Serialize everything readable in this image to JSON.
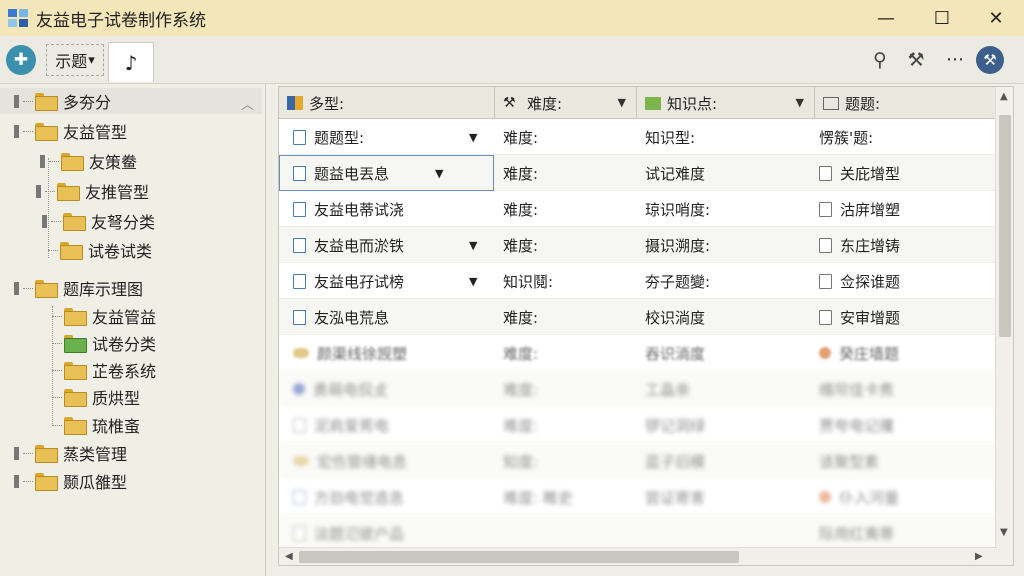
{
  "window": {
    "title": "友益电子试卷制作系统",
    "minimize_glyph": "—",
    "maximize_glyph": "☐",
    "close_glyph": "✕"
  },
  "toolbar": {
    "dropdown_label": "示题",
    "dropdown_caret": "▾",
    "tab_glyph": "♪",
    "more_glyph": "···"
  },
  "tree": {
    "items": [
      {
        "label": "多夯分"
      },
      {
        "label": "友益管型"
      },
      {
        "label": "友策鲞"
      },
      {
        "label": "友推管型"
      },
      {
        "label": "友弩分类"
      },
      {
        "label": "试卷试类"
      },
      {
        "label": "题库示理图"
      },
      {
        "label": "友益管益"
      },
      {
        "label": "试卷分类"
      },
      {
        "label": "芷卷系统"
      },
      {
        "label": "质烘型"
      },
      {
        "label": "琉椎蚉"
      },
      {
        "label": "蒸类管理"
      },
      {
        "label": "颞瓜雒型"
      }
    ]
  },
  "grid": {
    "headers": [
      {
        "label": "多型:"
      },
      {
        "label": "难度:"
      },
      {
        "label": "知识点:"
      },
      {
        "label": "题题:"
      }
    ],
    "rows": [
      {
        "c1": "题题型:",
        "c2": "难度:",
        "c3": "知识型:",
        "c4": "愣簇'题:"
      },
      {
        "c1": "题益电丟息",
        "c2": "难度:",
        "c3": "试记难度",
        "c4": "关庇增型"
      },
      {
        "c1": "友益电蒂试浇",
        "c2": "难度:",
        "c3": "琼识哨度:",
        "c4": "沽庰增塑"
      },
      {
        "c1": "友益电而淤铁",
        "c2": "难度:",
        "c3": "摄识溯度:",
        "c4": "东庄增铸"
      },
      {
        "c1": "友益电孖试榜",
        "c2": "知识鬩:",
        "c3": "夯子题變:",
        "c4": "佥探谁题"
      },
      {
        "c1": "友泓电荒息",
        "c2": "难度:",
        "c3": "校识淌度",
        "c4": "安审增题"
      },
      {
        "c1": "颜渠线徐觊塑",
        "c2": "难度:",
        "c3": "吞识淌度",
        "c4": "癸庄墙题"
      },
      {
        "c1": "勇萌电侃攴",
        "c2": "难度:",
        "c3": "工晶亲",
        "c4": "缗帘佳卡煮"
      },
      {
        "c1": "泥肩爱莠电",
        "c2": "难度:",
        "c3": "锣记洞绿",
        "c4": "贾夸电记攫"
      },
      {
        "c1": "宏伤管缮电息",
        "c2": "知度:",
        "c3": "蓝子旧模",
        "c4": "该聚型素"
      },
      {
        "c1": "方劲电觉造息",
        "c2": "难度: 睢史",
        "c3": "尝证寄害",
        "c4": "仆入河量"
      },
      {
        "c1": "淡题氾彼户品",
        "c2": "",
        "c3": "",
        "c4": "际用红夷蒂"
      }
    ]
  }
}
